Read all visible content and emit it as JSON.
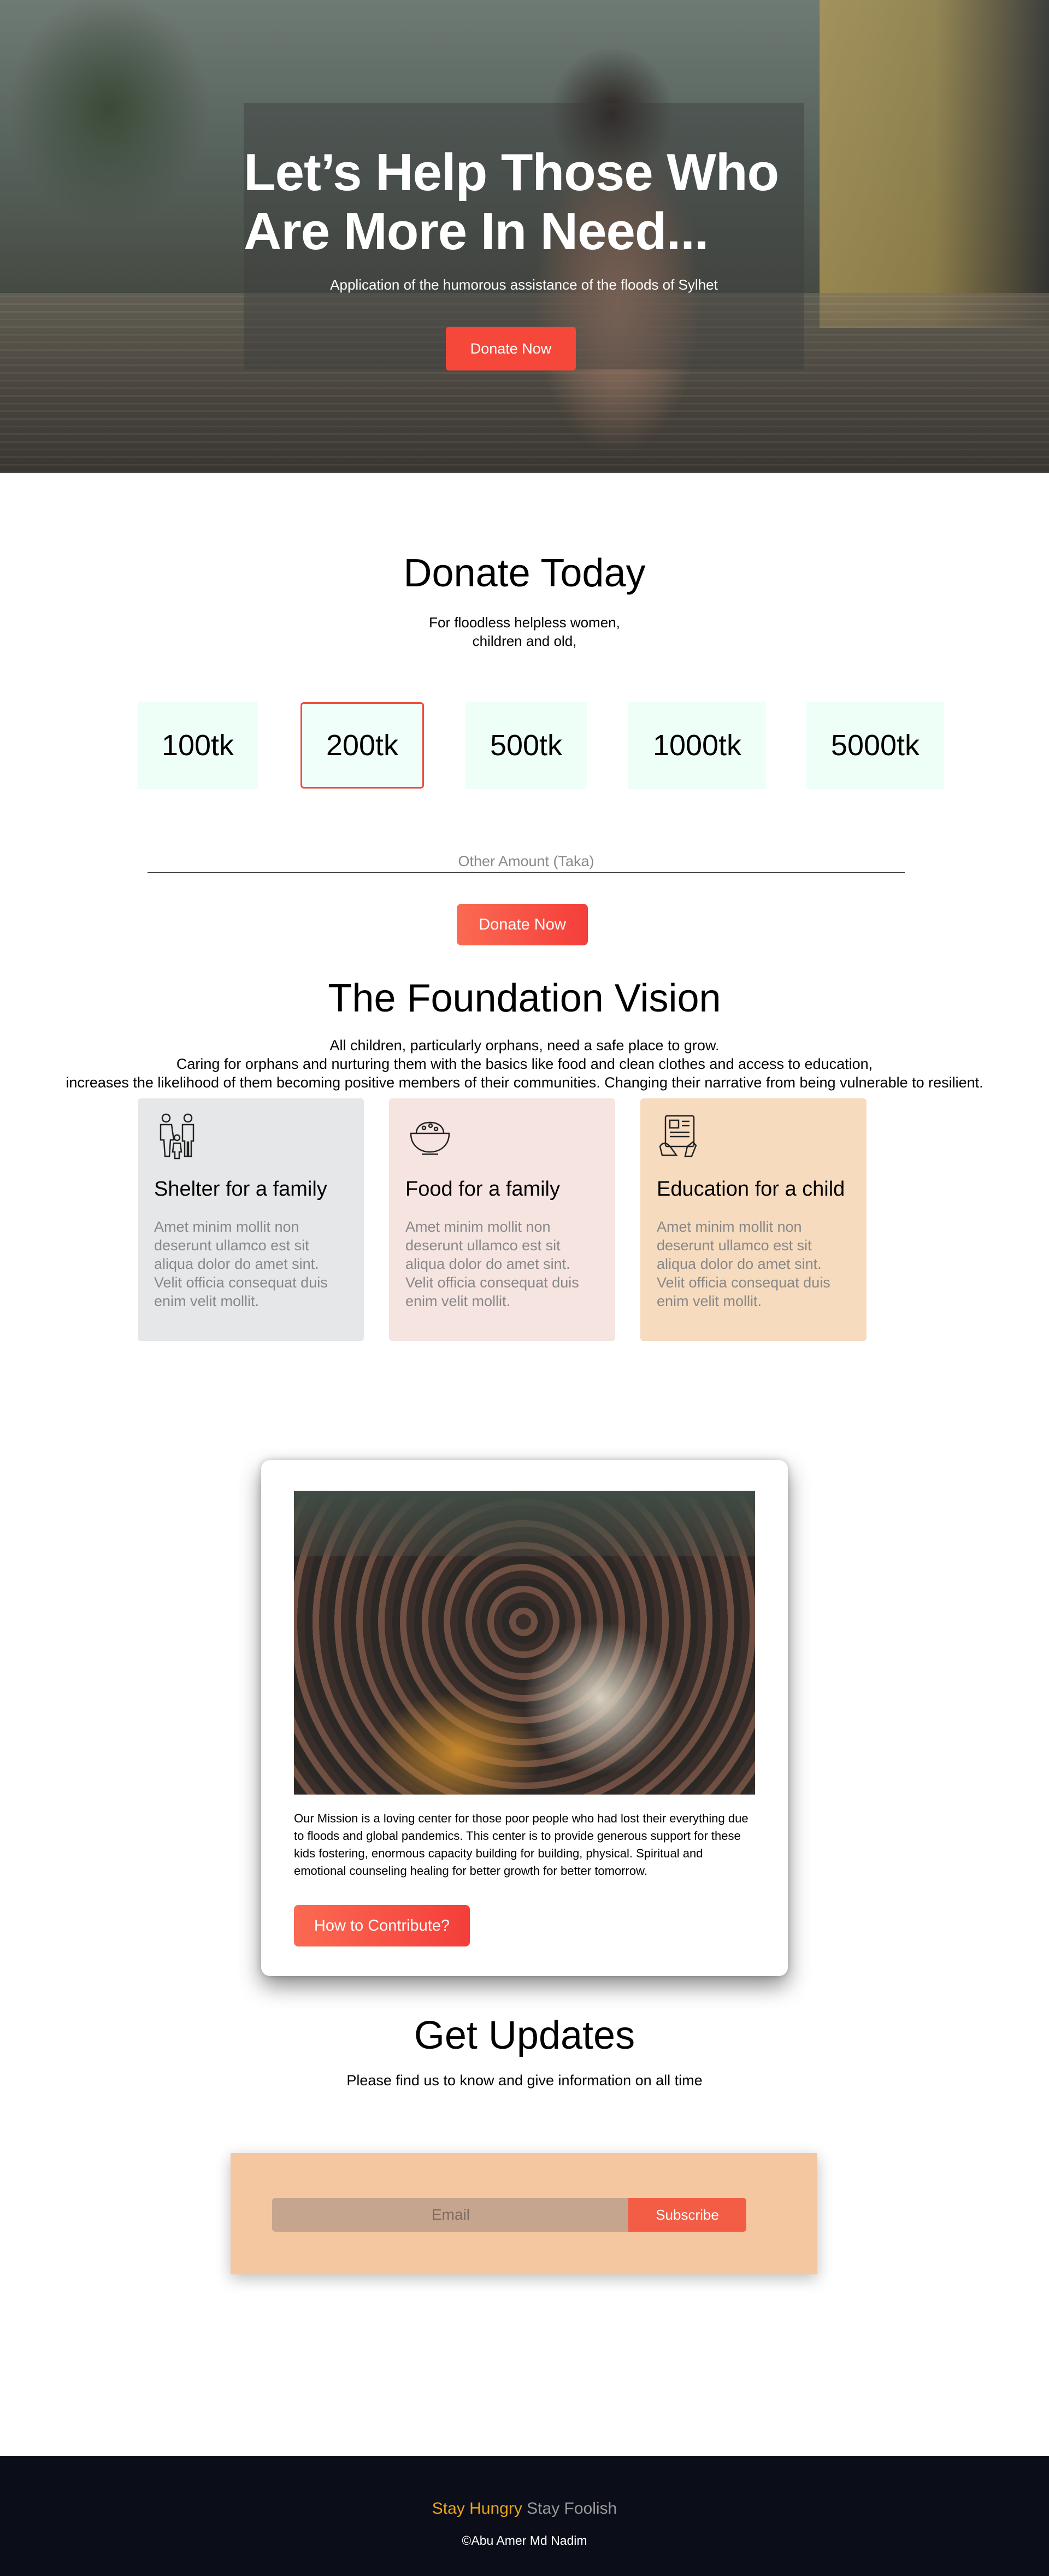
{
  "hero": {
    "title": "Let’s Help Those Who Are More In Need...",
    "subtitle": "Application of the humorous assistance of the floods of Sylhet",
    "button_label": "Donate Now"
  },
  "donate": {
    "title": "Donate Today",
    "subtitle_line1": "For floodless helpless women,",
    "subtitle_line2": "children and old,",
    "amounts": [
      "100tk",
      "200tk",
      "500tk",
      "1000tk",
      "5000tk"
    ],
    "selected_amount": "200tk",
    "other_amount_placeholder": "Other Amount (Taka)",
    "button_label": "Donate Now"
  },
  "vision": {
    "title": "The Foundation Vision",
    "text_line1": "All children, particularly orphans, need a safe place to grow.",
    "text_line2": "Caring for orphans and nurturing them with the basics like food and clean clothes and access to education,",
    "text_line3": "increases the likelihood of them becoming positive members of their communities. Changing their narrative from being vulnerable to resilient.",
    "cards": [
      {
        "title": "Shelter for a family",
        "text": "Amet minim mollit non deserunt ullamco est sit aliqua dolor do amet sint. Velit officia consequat duis enim velit mollit.",
        "icon": "family-icon",
        "color": "#e6e7e8"
      },
      {
        "title": "Food for a family",
        "text": "Amet minim mollit non deserunt ullamco est sit aliqua dolor do amet sint. Velit officia consequat duis enim velit mollit.",
        "icon": "food-bowl-icon",
        "color": "#f6e4e1"
      },
      {
        "title": "Education for a child",
        "text": "Amet minim mollit non deserunt ullamco est sit aliqua dolor do amet sint. Velit officia consequat duis enim velit mollit.",
        "icon": "education-icon",
        "color": "#f6dbbe"
      }
    ]
  },
  "mission": {
    "text": "Our Mission is a loving center for those poor people who had lost their everything due to floods and global pandemics. This center is to provide generous support for these kids fostering, enormous capacity building for building, physical. Spiritual and emotional counseling healing for better growth for better tomorrow.",
    "button_label": "How to Contribute?"
  },
  "updates": {
    "title": "Get Updates",
    "subtitle": "Please find us to know and give information on all time",
    "email_placeholder": "Email",
    "button_label": "Subscribe"
  },
  "footer": {
    "motto_part1": "Stay Hungry",
    "motto_part2": "Stay Foolish",
    "copyright": "©Abu Amer Md Nadim"
  },
  "colors": {
    "accent": "#f5473a",
    "amount_bg": "#eefff8",
    "footer_bg": "#0b0d18",
    "footer_highlight": "#e8a21d"
  }
}
